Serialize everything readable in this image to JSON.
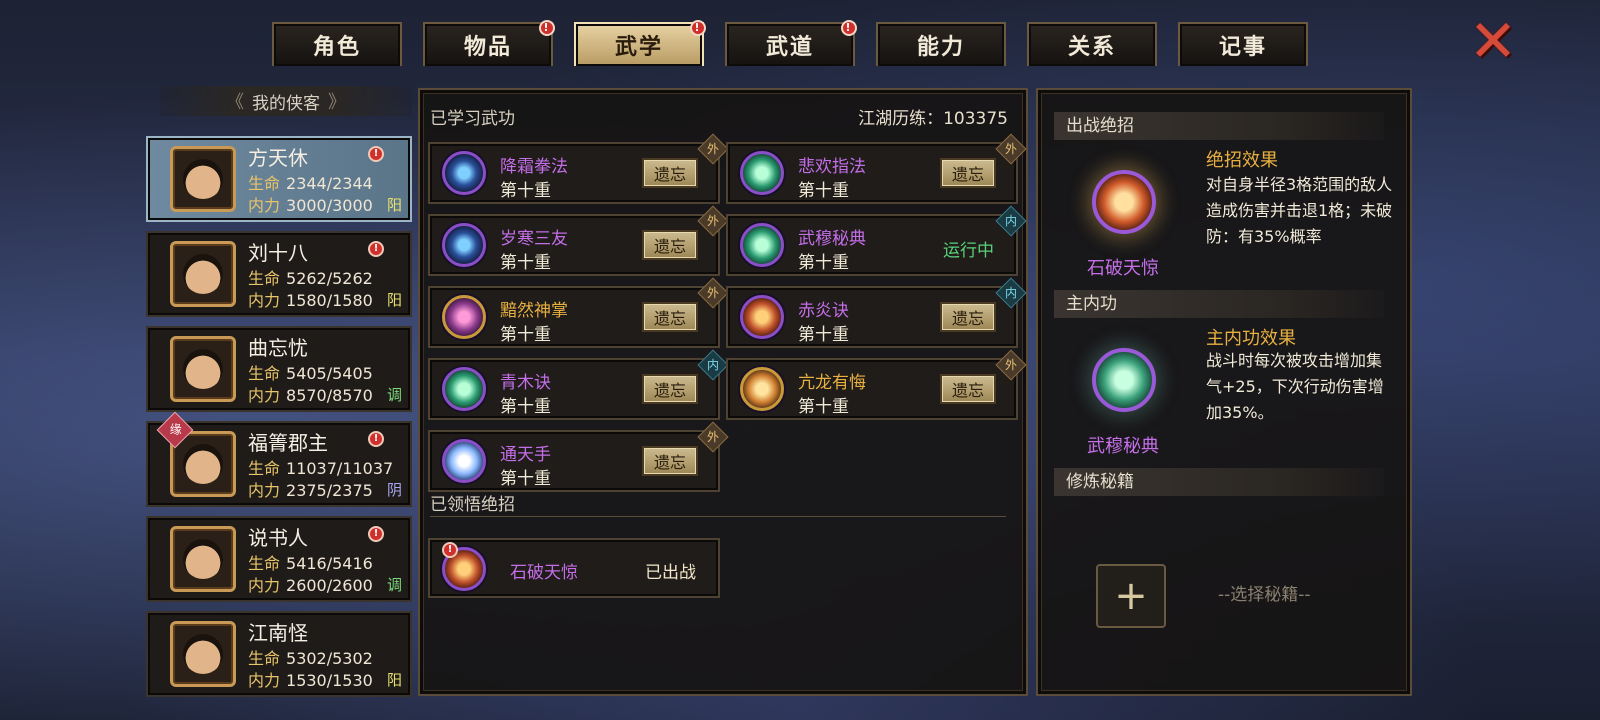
{
  "tabs": [
    {
      "label": "角色",
      "active": false,
      "alert": false
    },
    {
      "label": "物品",
      "active": false,
      "alert": true
    },
    {
      "label": "武学",
      "active": true,
      "alert": true
    },
    {
      "label": "武道",
      "active": false,
      "alert": true
    },
    {
      "label": "能力",
      "active": false,
      "alert": false
    },
    {
      "label": "关系",
      "active": false,
      "alert": false
    },
    {
      "label": "记事",
      "active": false,
      "alert": false
    }
  ],
  "close_icon": "✕",
  "roster": {
    "title": "我的侠客",
    "chars": [
      {
        "name": "方天休",
        "hp_label": "生命",
        "hp": "2344/2344",
        "mp_label": "内力",
        "mp": "3000/3000",
        "type": "阳",
        "type_color": "#e8e070",
        "alert": true,
        "yuan": false,
        "selected": true
      },
      {
        "name": "刘十八",
        "hp_label": "生命",
        "hp": "5262/5262",
        "mp_label": "内力",
        "mp": "1580/1580",
        "type": "阳",
        "type_color": "#e8e070",
        "alert": true,
        "yuan": false,
        "selected": false
      },
      {
        "name": "曲忘忧",
        "hp_label": "生命",
        "hp": "5405/5405",
        "mp_label": "内力",
        "mp": "8570/8570",
        "type": "调",
        "type_color": "#7ad87a",
        "alert": false,
        "yuan": false,
        "selected": false
      },
      {
        "name": "福箐郡主",
        "hp_label": "生命",
        "hp": "11037/11037",
        "mp_label": "内力",
        "mp": "2375/2375",
        "type": "阴",
        "type_color": "#a8a8f0",
        "alert": true,
        "yuan": true,
        "yuan_label": "缘",
        "selected": false
      },
      {
        "name": "说书人",
        "hp_label": "生命",
        "hp": "5416/5416",
        "mp_label": "内力",
        "mp": "2600/2600",
        "type": "调",
        "type_color": "#7ad87a",
        "alert": true,
        "yuan": false,
        "selected": false
      },
      {
        "name": "江南怪",
        "hp_label": "生命",
        "hp": "5302/5302",
        "mp_label": "内力",
        "mp": "1530/1530",
        "type": "阳",
        "type_color": "#e8e070",
        "alert": false,
        "yuan": false,
        "selected": false
      }
    ]
  },
  "middle": {
    "learned_title": "已学习武功",
    "exp_label": "江湖历练：103375",
    "forget_label": "遗忘",
    "running_label": "运行中",
    "skills": [
      {
        "name": "降霜拳法",
        "level": "第十重",
        "tag": "外",
        "tag_kind": "outer",
        "icon": "ice-fist",
        "icon_style": "",
        "name_style": "",
        "action": "forget"
      },
      {
        "name": "悲欢指法",
        "level": "第十重",
        "tag": "外",
        "tag_kind": "outer",
        "icon": "green-finger",
        "icon_style": "green",
        "name_style": "",
        "action": "forget"
      },
      {
        "name": "岁寒三友",
        "level": "第十重",
        "tag": "外",
        "tag_kind": "outer",
        "icon": "blue-swirl",
        "icon_style": "",
        "name_style": "",
        "action": "forget"
      },
      {
        "name": "武穆秘典",
        "level": "第十重",
        "tag": "内",
        "tag_kind": "inner",
        "icon": "green-claw",
        "icon_style": "green",
        "name_style": "",
        "action": "running"
      },
      {
        "name": "黯然神掌",
        "level": "第十重",
        "tag": "外",
        "tag_kind": "outer",
        "icon": "pink-palm",
        "icon_style": "gold",
        "name_style": "gold",
        "action": "forget"
      },
      {
        "name": "赤炎诀",
        "level": "第十重",
        "tag": "内",
        "tag_kind": "inner",
        "icon": "red-flame",
        "icon_style": "red",
        "name_style": "",
        "action": "forget"
      },
      {
        "name": "青木诀",
        "level": "第十重",
        "tag": "内",
        "tag_kind": "inner",
        "icon": "green-wood",
        "icon_style": "green",
        "name_style": "",
        "action": "forget"
      },
      {
        "name": "亢龙有悔",
        "level": "第十重",
        "tag": "外",
        "tag_kind": "outer",
        "icon": "dragon-strike",
        "icon_style": "fire",
        "name_style": "gold",
        "action": "forget"
      },
      {
        "name": "通天手",
        "level": "第十重",
        "tag": "外",
        "tag_kind": "outer",
        "icon": "heaven-hand",
        "icon_style": "ice",
        "name_style": "",
        "action": "forget"
      }
    ],
    "ult_title": "已领悟绝招",
    "ult": {
      "name": "石破天惊",
      "status": "已出战",
      "alert": true
    }
  },
  "right": {
    "battle_title": "出战绝招",
    "battle_skill_name": "石破天惊",
    "battle_effect_title": "绝招效果",
    "battle_effect_text": "对自身半径3格范围的敌人造成伤害并击退1格；未破防：有35%概率",
    "inner_title": "主内功",
    "inner_skill_name": "武穆秘典",
    "inner_effect_title": "主内功效果",
    "inner_effect_text": "战斗时每次被攻击增加集气+25，下次行动伤害增加35%。",
    "manual_title": "修炼秘籍",
    "add_symbol": "+",
    "select_hint": "--选择秘籍--"
  }
}
